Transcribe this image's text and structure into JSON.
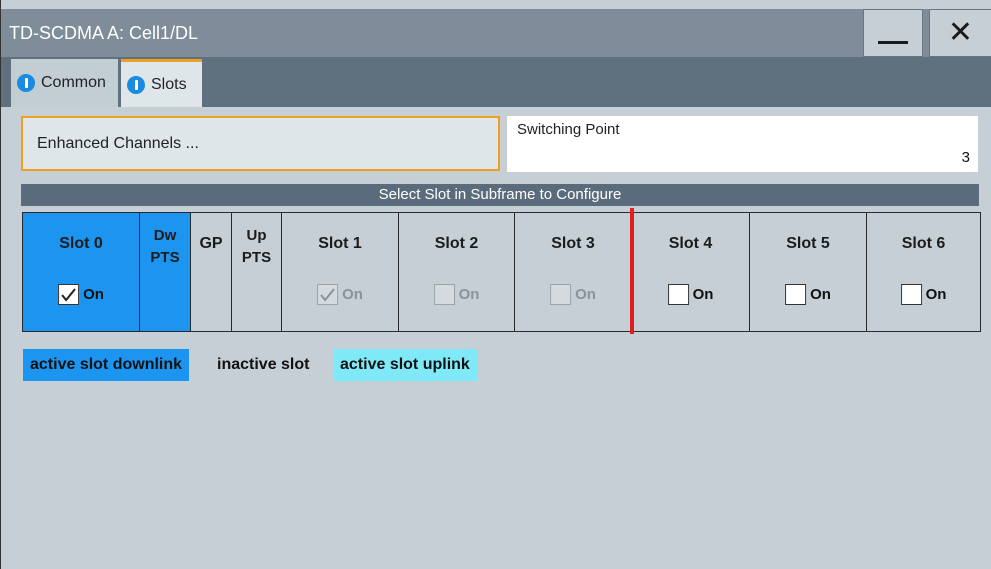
{
  "window": {
    "title": "TD-SCDMA A: Cell1/DL",
    "minimize_icon": "minimize-icon",
    "close_icon": "close-icon",
    "close_glyph": "✕"
  },
  "tabs": [
    {
      "label": "Common",
      "icon": "info-icon",
      "active": false
    },
    {
      "label": "Slots",
      "icon": "info-icon",
      "active": true
    }
  ],
  "enhanced_channels_button": "Enhanced Channels ...",
  "switching_point": {
    "label": "Switching Point",
    "value": "3"
  },
  "slot_header": "Select Slot in Subframe to Configure",
  "slots": [
    {
      "label": "Slot 0",
      "on_label": "On",
      "checked": true,
      "state": "active-downlink"
    },
    {
      "label_top": "Dw",
      "label_bottom": "PTS",
      "state": "active-downlink"
    },
    {
      "label": "GP",
      "state": "inactive"
    },
    {
      "label_top": "Up",
      "label_bottom": "PTS",
      "state": "inactive"
    },
    {
      "label": "Slot 1",
      "on_label": "On",
      "checked": true,
      "disabled": true,
      "state": "inactive"
    },
    {
      "label": "Slot 2",
      "on_label": "On",
      "checked": false,
      "disabled": true,
      "state": "inactive"
    },
    {
      "label": "Slot 3",
      "on_label": "On",
      "checked": false,
      "disabled": true,
      "state": "inactive"
    },
    {
      "label": "Slot 4",
      "on_label": "On",
      "checked": false,
      "state": "inactive"
    },
    {
      "label": "Slot 5",
      "on_label": "On",
      "checked": false,
      "state": "inactive"
    },
    {
      "label": "Slot 6",
      "on_label": "On",
      "checked": false,
      "state": "inactive"
    }
  ],
  "legend": {
    "active_downlink": "active slot downlink",
    "inactive": "inactive slot",
    "active_uplink": "active slot uplink"
  },
  "colors": {
    "active_downlink": "#1b95ef",
    "active_uplink": "#7fe9f7",
    "inactive": "#c5cfd5",
    "switch_point_marker": "#e02020",
    "focus_border": "#f0a020"
  }
}
